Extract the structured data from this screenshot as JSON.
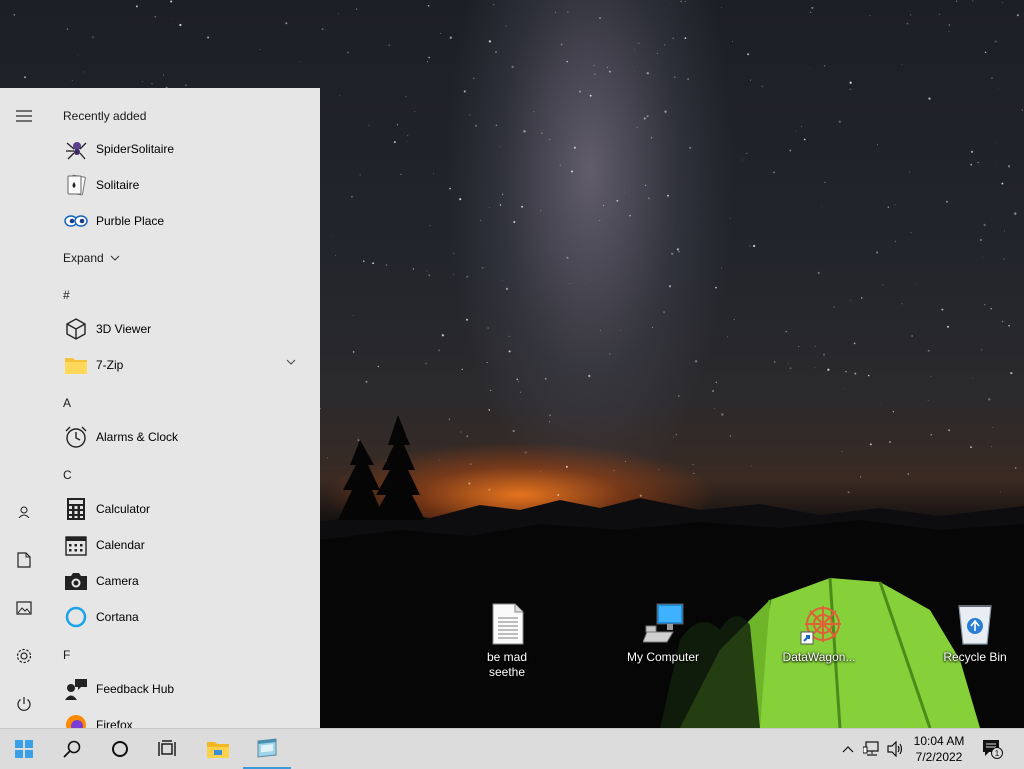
{
  "desktop": {
    "icons": [
      {
        "name": "be-mad-seethe-icon",
        "label": "be mad\nseethe"
      },
      {
        "name": "my-computer-icon",
        "label": "My Computer"
      },
      {
        "name": "datawagon-icon",
        "label": "DataWagon..."
      },
      {
        "name": "recycle-bin-icon",
        "label": "Recycle Bin"
      }
    ]
  },
  "start_menu": {
    "recently_added": "Recently added",
    "recent": [
      "SpiderSolitaire",
      "Solitaire",
      "Purble Place"
    ],
    "expand": "Expand",
    "sections": {
      "hash": "#",
      "a": "A",
      "c": "C",
      "f": "F"
    },
    "apps": {
      "viewer_3d": "3D Viewer",
      "zip7": "7-Zip",
      "alarms": "Alarms & Clock",
      "calculator": "Calculator",
      "calendar": "Calendar",
      "camera": "Camera",
      "cortana": "Cortana",
      "feedback": "Feedback Hub",
      "firefox": "Firefox"
    },
    "rail_icons": [
      "hamburger-menu-icon",
      "user-icon",
      "documents-icon",
      "pictures-icon",
      "settings-gear-icon",
      "power-icon"
    ]
  },
  "taskbar": {
    "buttons": [
      "start-windows-icon",
      "search-icon",
      "cortana-circle-icon",
      "task-view-icon",
      "file-explorer-icon",
      "app-window-icon"
    ],
    "tray": [
      "chevron-up-icon",
      "network-icon",
      "volume-icon"
    ],
    "time": "10:04 AM",
    "date": "7/2/2022",
    "notification_count": "1"
  },
  "colors": {
    "start_bg": "#e6e6e6",
    "taskbar_bg": "#dcdcdc",
    "accent": "#0078d7",
    "tent_green": "#8fd93a"
  }
}
